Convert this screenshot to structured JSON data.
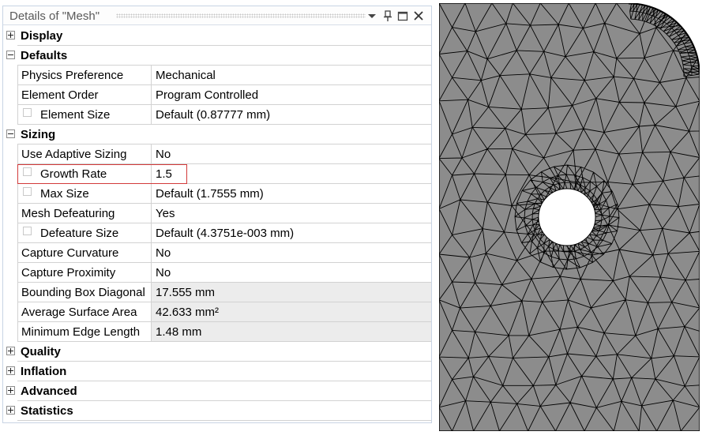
{
  "details_panel": {
    "title": "Details of \"Mesh\"",
    "title_icons": [
      "dropdown-arrow-icon",
      "pin-icon",
      "maximize-icon",
      "close-icon"
    ],
    "highlight_color": "#d23a3a",
    "categories": {
      "display": {
        "label": "Display",
        "expanded": false
      },
      "defaults": {
        "label": "Defaults",
        "expanded": true,
        "rows": [
          {
            "name": "Physics Preference",
            "value": "Mechanical"
          },
          {
            "name": "Element Order",
            "value": "Program Controlled"
          },
          {
            "name": "Element Size",
            "value": "Default (0.87777 mm)",
            "checkbox": true
          }
        ]
      },
      "sizing": {
        "label": "Sizing",
        "expanded": true,
        "rows": [
          {
            "name": "Use Adaptive Sizing",
            "value": "No"
          },
          {
            "name": "Growth Rate",
            "value": "1.5",
            "checkbox": true,
            "highlighted": true
          },
          {
            "name": "Max Size",
            "value": "Default (1.7555 mm)",
            "checkbox": true
          },
          {
            "name": "Mesh Defeaturing",
            "value": "Yes"
          },
          {
            "name": "Defeature Size",
            "value": "Default (4.3751e-003 mm)",
            "checkbox": true
          },
          {
            "name": "Capture Curvature",
            "value": "No"
          },
          {
            "name": "Capture Proximity",
            "value": "No"
          },
          {
            "name": "Bounding Box Diagonal",
            "value": "17.555 mm",
            "readonly": true
          },
          {
            "name": "Average Surface Area",
            "value": "42.633 mm²",
            "readonly": true
          },
          {
            "name": "Minimum Edge Length",
            "value": "1.48 mm",
            "readonly": true
          }
        ]
      },
      "quality": {
        "label": "Quality",
        "expanded": false
      },
      "inflation": {
        "label": "Inflation",
        "expanded": false
      },
      "advanced": {
        "label": "Advanced",
        "expanded": false
      },
      "statistics": {
        "label": "Statistics",
        "expanded": false
      }
    }
  },
  "mesh_view": {
    "fill_color": "#8c8c8c",
    "edge_color": "#000000",
    "hole_color": "#ffffff"
  }
}
